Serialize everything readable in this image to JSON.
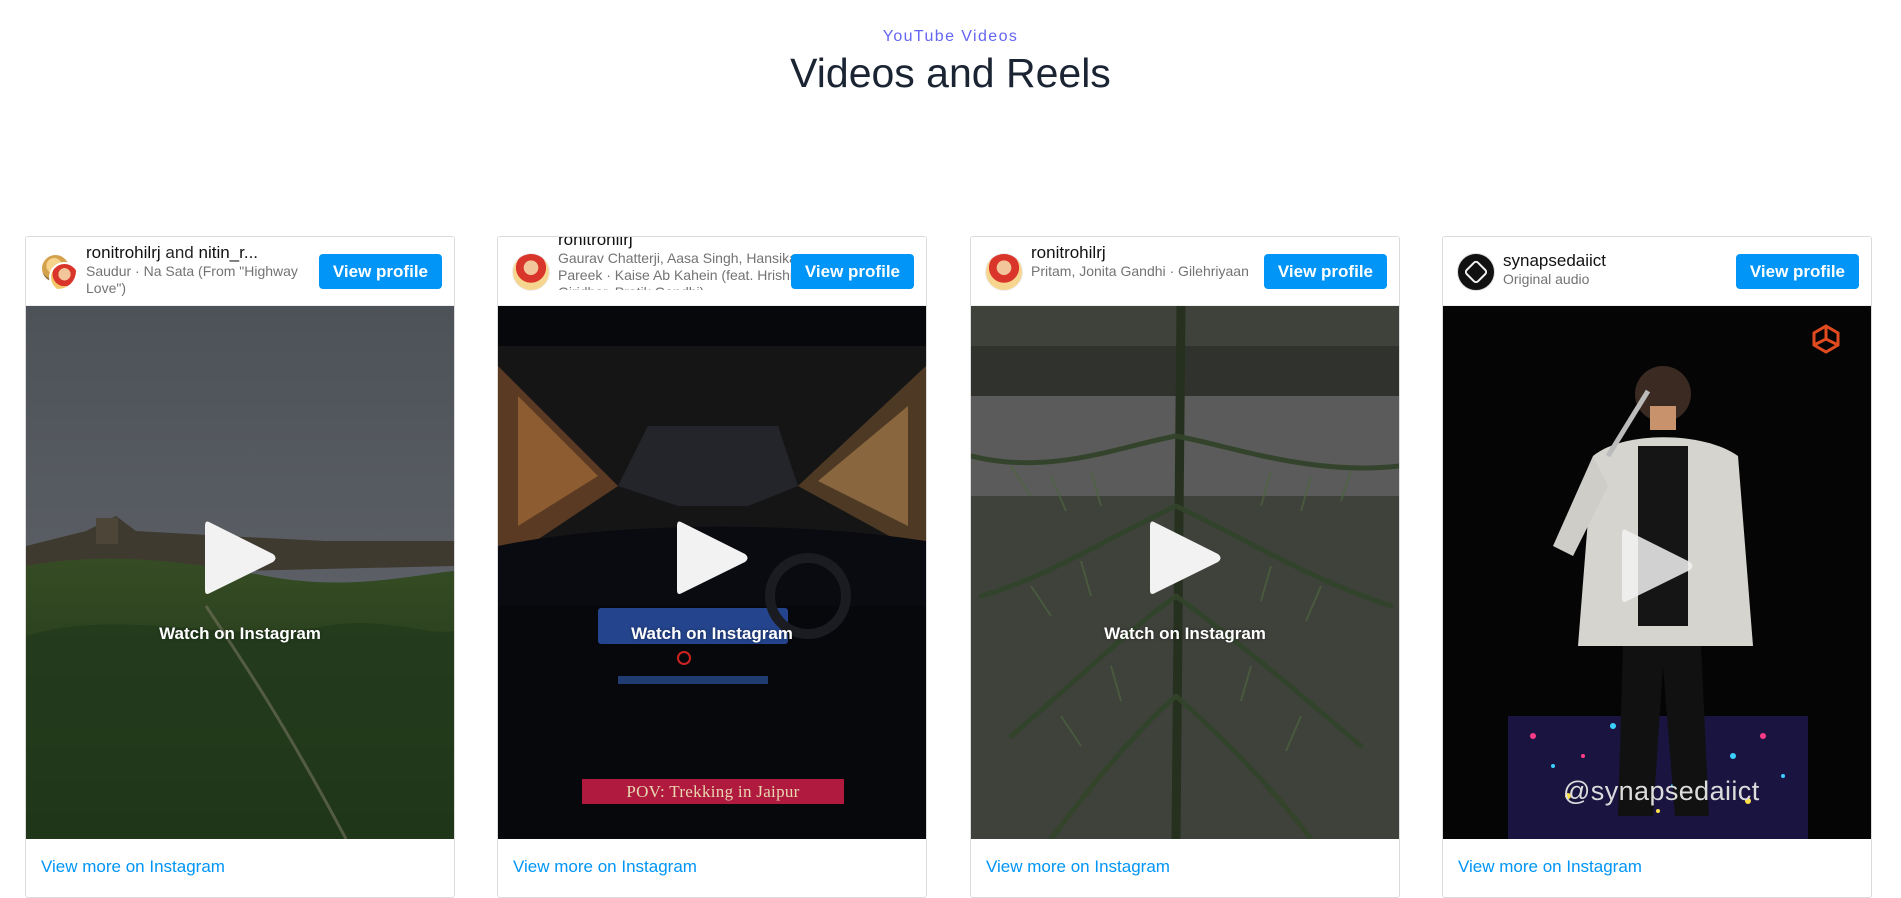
{
  "section": {
    "eyebrow": "YouTube Videos",
    "title": "Videos and Reels"
  },
  "cards": [
    {
      "username": "ronitrohilrj",
      "joiner": "and",
      "collaborator": "nitin_r...",
      "audio": "Saudur · Na Sata (From \"Highway Love\")",
      "button": "View profile",
      "watch": "Watch on Instagram",
      "more": "View more on Instagram"
    },
    {
      "username": "ronitrohilrj",
      "audio": "Gaurav Chatterji, Aasa Singh, Hansika Pareek · Kaise Ab Kahein (feat. Hrishi Giridhar, Pratik Gandhi)",
      "button": "View profile",
      "watch": "Watch on Instagram",
      "overlay": "POV: Trekking in Jaipur",
      "more": "View more on Instagram"
    },
    {
      "username": "ronitrohilrj",
      "audio": "Pritam, Jonita Gandhi · Gilehriyaan",
      "button": "View profile",
      "watch": "Watch on Instagram",
      "more": "View more on Instagram"
    },
    {
      "username": "synapsedaiict",
      "audio": "Original audio",
      "button": "View profile",
      "handle": "@synapsedaiict",
      "more": "View more on Instagram"
    }
  ],
  "colors": {
    "accent": "#6366f1",
    "instagram_blue": "#0095f6"
  },
  "icons": [
    "play-icon",
    "synapse-logo-icon"
  ]
}
